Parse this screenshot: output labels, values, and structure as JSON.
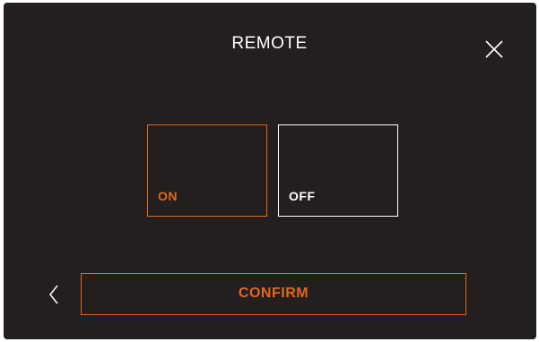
{
  "header": {
    "title": "REMOTE",
    "close_icon": "close-icon"
  },
  "options": [
    {
      "label": "ON",
      "selected": true
    },
    {
      "label": "OFF",
      "selected": false
    }
  ],
  "footer": {
    "back_icon": "chevron-left-icon",
    "confirm_label": "CONFIRM"
  },
  "colors": {
    "background": "#231f1e",
    "accent": "#e3671f",
    "text": "#ffffff"
  }
}
